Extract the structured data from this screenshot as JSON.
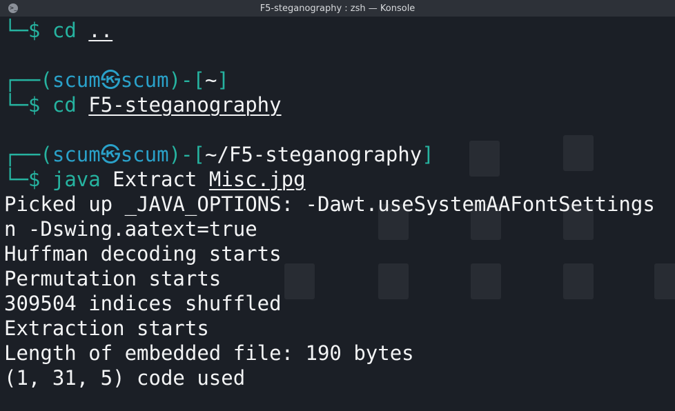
{
  "window": {
    "title": "F5-steganography : zsh — Konsole",
    "icon": "konsole-icon"
  },
  "terminal": {
    "colors": {
      "prompt": "#26b3a0",
      "user": "#2aa1c9",
      "text": "#f3f4f5",
      "background": "#1b1f26"
    },
    "lines": [
      {
        "corner": "└─",
        "dollar": "$",
        "cmd": "cd",
        "arg": ".."
      },
      {
        "corner": "┌──",
        "open": "(",
        "user": "scum",
        "sep": "㉿",
        "host": "scum",
        "close": ")-[",
        "path": "~",
        "end": "]"
      },
      {
        "corner": "└─",
        "dollar": "$",
        "cmd": "cd",
        "arg": "F5-steganography"
      },
      {
        "corner": "┌──",
        "open": "(",
        "user": "scum",
        "sep": "㉿",
        "host": "scum",
        "close": ")-[",
        "path": "~/F5-steganography",
        "end": "]"
      },
      {
        "corner": "└─",
        "dollar": "$",
        "cmd": "java",
        "mid": "Extract",
        "arg": "Misc.jpg"
      }
    ],
    "output": [
      "Picked up _JAVA_OPTIONS: -Dawt.useSystemAAFontSettings",
      "n -Dswing.aatext=true",
      "Huffman decoding starts",
      "Permutation starts",
      "309504 indices shuffled",
      "Extraction starts",
      "Length of embedded file: 190 bytes",
      "(1, 31, 5) code used"
    ]
  }
}
